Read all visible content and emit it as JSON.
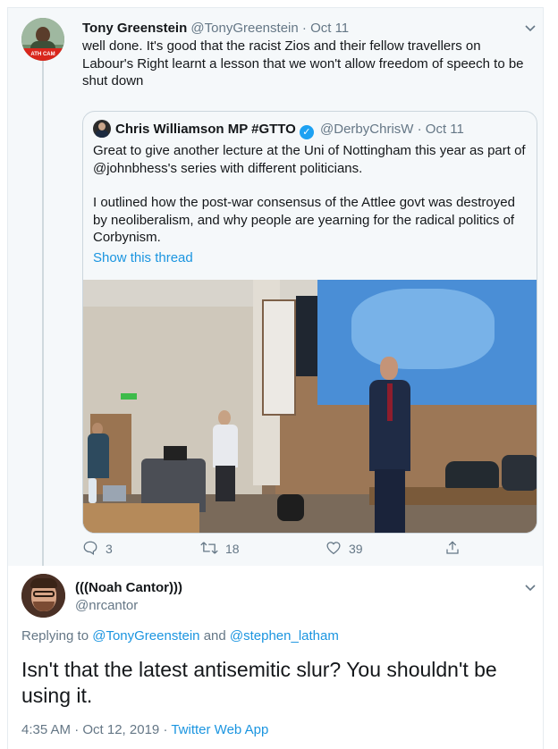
{
  "parent_tweet": {
    "author_name": "Tony Greenstein",
    "author_handle": "@TonyGreenstein",
    "separator": "·",
    "time": "Oct 11",
    "avatar_text": "ATH CAM",
    "text": "well done.  It's good that the racist Zios and their fellow travellers on Labour's Right learnt a lesson that we won't allow freedom of speech to be shut down",
    "quoted": {
      "author_name": "Chris Williamson MP #GTTO",
      "verified_icon": "verified-badge-icon",
      "author_handle": "@DerbyChrisW",
      "separator": "·",
      "time": "Oct 11",
      "paragraph1": "Great to give another lecture at the Uni of Nottingham this year as part of @johnbhess's series with different politicians.",
      "paragraph2": "I outlined how the post-war consensus of the Attlee govt was destroyed by neoliberalism, and why people are yearning for the radical politics of Corbynism.",
      "show_thread": "Show this thread"
    },
    "actions": {
      "reply_count": "3",
      "retweet_count": "18",
      "like_count": "39",
      "icons": [
        "reply-icon",
        "retweet-icon",
        "like-icon",
        "share-icon"
      ]
    }
  },
  "reply_tweet": {
    "author_name": "(((Noah Cantor)))",
    "author_handle": "@nrcantor",
    "replying_prefix": "Replying to",
    "replying_to_1": "@TonyGreenstein",
    "replying_and": "and",
    "replying_to_2": "@stephen_latham",
    "text": "Isn't that the latest antisemitic slur? You shouldn't be using it.",
    "timestamp": "4:35 AM · Oct 12, 2019",
    "meta_separator": "·",
    "client": "Twitter Web App"
  },
  "colors": {
    "link": "#1b95e0",
    "secondary_text": "#657786",
    "verified": "#1da1f2",
    "parent_background": "#f5f8fa"
  }
}
